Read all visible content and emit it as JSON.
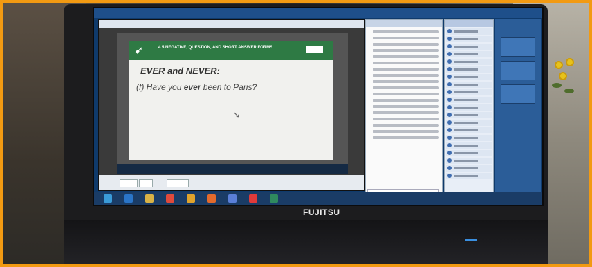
{
  "slide": {
    "header": "4.5 NEGATIVE, QUESTION, AND SHORT ANSWER FORMS",
    "title": "EVER and NEVER:",
    "question_prefix": "(f)",
    "question_before": "Have you",
    "question_bold": "ever",
    "question_after": "been  to Paris?"
  },
  "laptop": {
    "brand": "FUJITSU"
  },
  "colors": {
    "frame": "#f29a12",
    "slide_header": "#2e7a44",
    "app_blue": "#2b5d98"
  }
}
